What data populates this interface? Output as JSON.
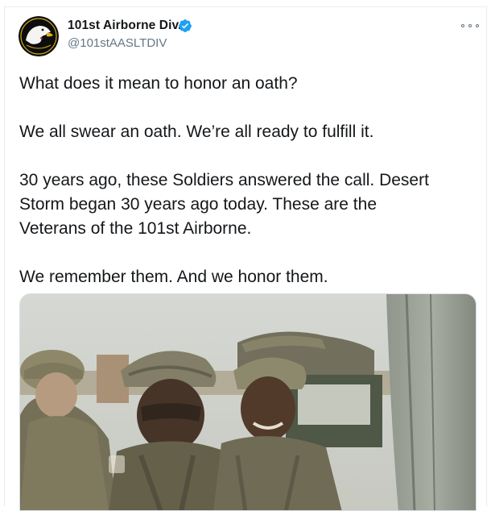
{
  "account": {
    "display_name": "101st Airborne Div.",
    "handle": "@101stAASLTDIV",
    "verified": true,
    "avatar_icon": "screaming-eagle-patch-icon"
  },
  "tweet": {
    "paragraphs": [
      [
        "What does it mean to honor an oath?"
      ],
      [
        "We all swear an oath. We’re all ready to fulfill it."
      ],
      [
        "30 years ago, these Soldiers answered the call. Desert",
        "Storm began 30 years ago today. These are the",
        "Veterans of the 101st Airborne."
      ],
      [
        "We remember them. And we honor them."
      ]
    ]
  },
  "media": {
    "type": "photo",
    "icon": "soldiers-photo"
  },
  "colors": {
    "text_primary": "#14171a",
    "text_secondary": "#657786",
    "verified_blue": "#1da1f2",
    "border": "#e6ecf0"
  }
}
